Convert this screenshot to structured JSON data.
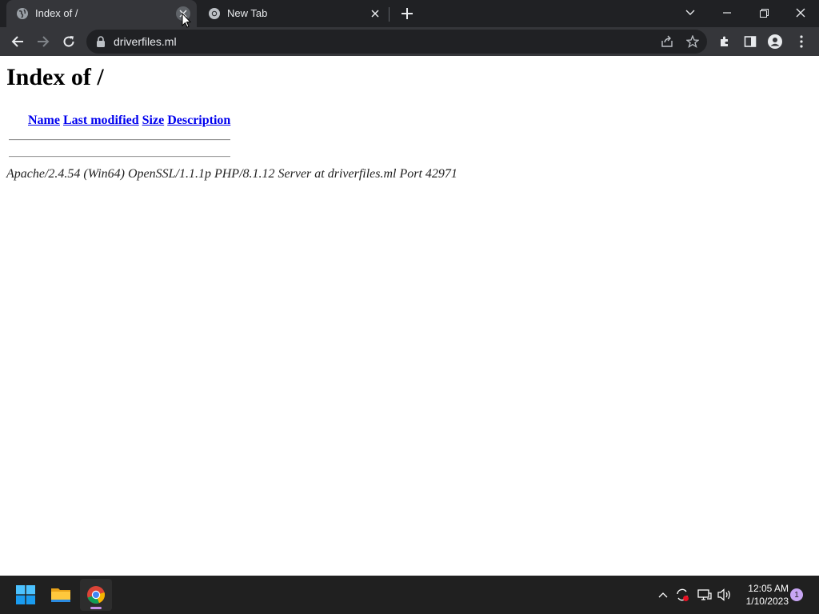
{
  "browser": {
    "tabs": [
      {
        "title": "Index of /",
        "active": true
      },
      {
        "title": "New Tab",
        "active": false
      }
    ],
    "address_bar": {
      "url": "driverfiles.ml"
    },
    "colors": {
      "frame": "#202124",
      "toolbar": "#35363a",
      "text": "#e8eaed"
    }
  },
  "page": {
    "heading": "Index of /",
    "columns": [
      "Name",
      "Last modified",
      "Size",
      "Description"
    ],
    "server_signature": "Apache/2.4.54 (Win64) OpenSSL/1.1.1p PHP/8.1.12 Server at driverfiles.ml Port 42971",
    "colors": {
      "link": "#0000ee"
    }
  },
  "taskbar": {
    "apps": [
      "start-icon",
      "file-explorer-icon",
      "chrome-icon"
    ],
    "clock": {
      "time": "12:05 AM",
      "date": "1/10/2023"
    },
    "notification_count": "1"
  }
}
